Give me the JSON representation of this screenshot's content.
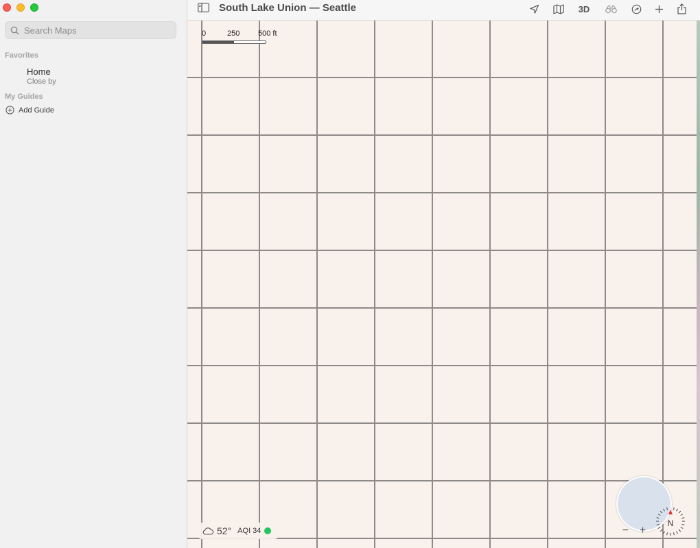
{
  "window": {
    "title": "South Lake Union — Seattle"
  },
  "search": {
    "placeholder": "Search Maps",
    "value": ""
  },
  "sidebar": {
    "favorites_header": "Favorites",
    "favorites": [
      {
        "title": "Home",
        "subtitle": "Close by",
        "icon": "home-icon"
      }
    ],
    "guides_header": "My Guides",
    "add_guide_label": "Add Guide"
  },
  "toolbar": {
    "view_3d_label": "3D",
    "icons": [
      "sidebar-toggle-icon",
      "location-arrow-icon",
      "map-mode-icon",
      "look-around-icon",
      "track-icon",
      "plus-icon",
      "share-icon"
    ]
  },
  "map": {
    "scale": {
      "zero": "0",
      "mid": "250",
      "end": "500 ft",
      "filled_fraction": 0.5
    },
    "weather": {
      "temperature": "52°",
      "aqi_label": "AQI 34",
      "aqi_color": "#22c55e"
    },
    "zoom_out": "−",
    "zoom_in": "+",
    "compass_label": "N"
  },
  "colors": {
    "map_background": "#f8f1ec",
    "grid_line": "#8e8a87",
    "accent_red": "#e0342c"
  }
}
